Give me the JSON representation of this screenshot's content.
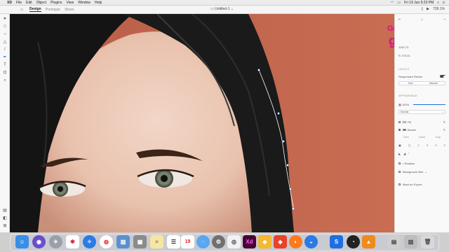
{
  "menubar": {
    "app_name": "XD",
    "items": [
      "File",
      "Edit",
      "Object",
      "Plugins",
      "View",
      "Window",
      "Help"
    ],
    "datetime": "Fri 19 Jun 5:23 PM"
  },
  "appbar": {
    "tabs": [
      "Design",
      "Prototype",
      "Share"
    ],
    "active_tab": "Design",
    "document_title": "Untitled-1",
    "zoom": "739.1%"
  },
  "panel": {
    "values": [
      "1103.73",
      "273.01"
    ],
    "layout_header": "LAYOUT",
    "responsive_resize_label": "Responsive Resize",
    "resize_options": [
      "Auto",
      "Manual"
    ],
    "appearance_header": "APPEARANCE",
    "opacity": "100%",
    "blend_mode": "Normal",
    "fill_label": "Fill",
    "border_label": "Border",
    "border_sub": [
      "Size",
      "Dash",
      "Gap"
    ],
    "shadow_label": "Shadow",
    "background_blur_label": "Background Blur",
    "mark_for_export_label": "Mark for Export",
    "fill_color": "#ffffff",
    "border_color": "#555555"
  },
  "watermark": {
    "line1": "Graphics",
    "line2": "guruji"
  },
  "colors": {
    "canvas_background": "#c4674e",
    "accent": "#1b6fd8",
    "watermark_magenta": "#d0147a"
  }
}
